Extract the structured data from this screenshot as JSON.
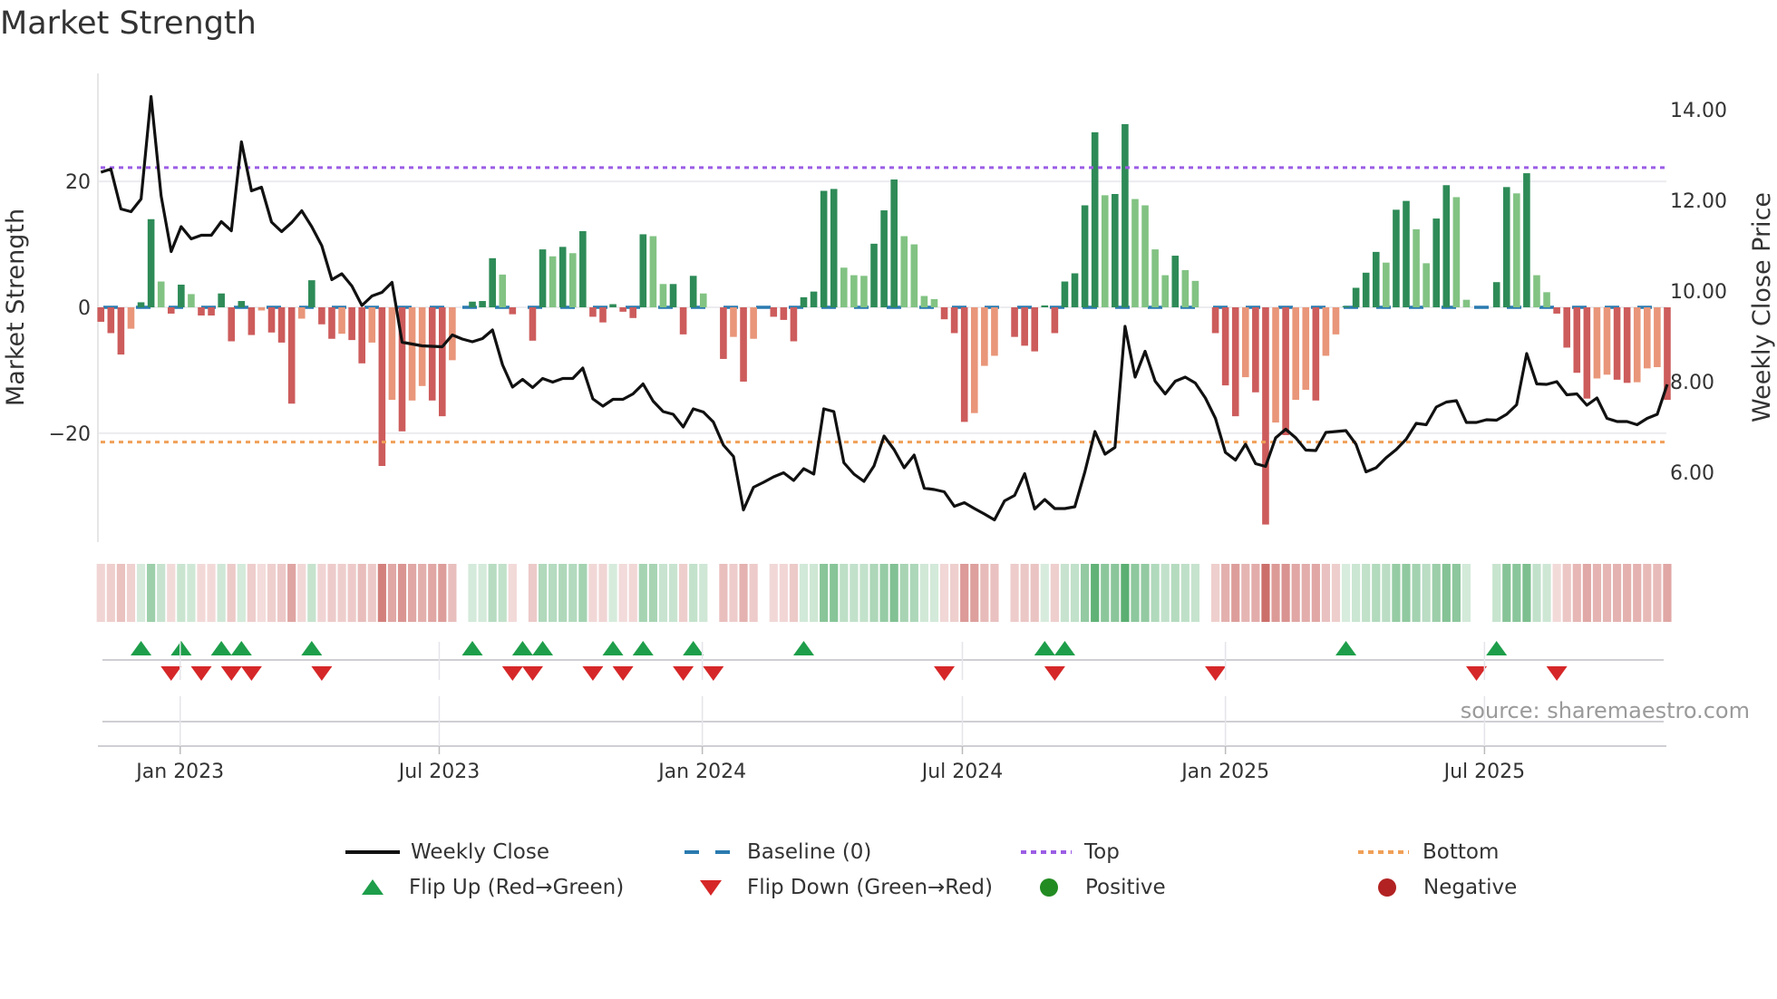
{
  "title": "Market Strength",
  "source": "source: sharemaestro.com",
  "legend": {
    "weekly_close": "Weekly Close",
    "baseline": "Baseline (0)",
    "top": "Top",
    "bottom": "Bottom",
    "flip_up": "Flip Up (Red→Green)",
    "flip_down": "Flip Down (Green→Red)",
    "positive": "Positive",
    "negative": "Negative"
  },
  "colors": {
    "price_line": "#111111",
    "baseline": "#2a7ab0",
    "top": "#9b5de5",
    "bottom": "#f0a058",
    "bar_up_strong": "#2e8b57",
    "bar_up_weak": "#82c383",
    "bar_down_strong": "#cd5c5c",
    "bar_down_weak": "#e9967a",
    "flip_up": "#1e9e4a",
    "flip_down": "#d62728",
    "positive": "#228b22",
    "negative": "#b22222"
  },
  "chart_data": {
    "type": "bar+line",
    "title": "Market Strength",
    "ylabel": "Market Strength",
    "y2label": "Weekly Close Price",
    "ylim": [
      -37.3,
      37.3
    ],
    "y2lim": [
      4.5,
      14.7
    ],
    "yticks": [
      {
        "v": -20,
        "label": "−20"
      },
      {
        "v": 0,
        "label": "0"
      },
      {
        "v": 20,
        "label": "20"
      }
    ],
    "y2ticks": [
      {
        "v": 6,
        "label": "6.00"
      },
      {
        "v": 8,
        "label": "8.00"
      },
      {
        "v": 10,
        "label": "10.00"
      },
      {
        "v": 12,
        "label": "12.00"
      },
      {
        "v": 14,
        "label": "14.00"
      }
    ],
    "xticks": [
      {
        "week": 7.9,
        "label": "Jan 2023"
      },
      {
        "week": 33.7,
        "label": "Jul 2023"
      },
      {
        "week": 59.9,
        "label": "Jan 2024"
      },
      {
        "week": 85.8,
        "label": "Jul 2024"
      },
      {
        "week": 112.0,
        "label": "Jan 2025"
      },
      {
        "week": 137.8,
        "label": "Jul 2025"
      }
    ],
    "top_level": 22.2,
    "bottom_level": -21.4,
    "baseline": 0,
    "strength": [
      -2.3,
      -4.1,
      -7.5,
      -3.4,
      0.8,
      14,
      4.1,
      -1,
      3.6,
      2.1,
      -1.3,
      -1.3,
      2.2,
      -5.4,
      1.0,
      -4.4,
      -0.5,
      -4,
      -5.6,
      -15.3,
      -1.8,
      4.3,
      -2.7,
      -5,
      -4.2,
      -5.2,
      -8.9,
      -5.6,
      -25.2,
      -14.7,
      -19.7,
      -14.8,
      -12.5,
      -14.8,
      -17.3,
      -8.4,
      0,
      0.9,
      1.0,
      7.8,
      5.2,
      -1.1,
      0,
      -5.3,
      9.2,
      8.1,
      9.6,
      8.6,
      12.1,
      -1.5,
      -2.4,
      0.5,
      -0.7,
      -1.7,
      11.6,
      11.3,
      3.7,
      3.7,
      -4.3,
      5.0,
      2.2,
      0,
      -8.2,
      -4.7,
      -11.8,
      -5,
      0,
      -1.5,
      -2,
      -5.4,
      1.6,
      2.5,
      18.5,
      18.8,
      6.3,
      5.1,
      5,
      10.1,
      15.4,
      20.3,
      11.3,
      10.0,
      1.8,
      1.3,
      -1.9,
      -4.1,
      -18.2,
      -16.8,
      -9.3,
      -7.7,
      0,
      -4.7,
      -6.1,
      -7,
      0.3,
      -4.1,
      4.1,
      5.4,
      16.2,
      27.8,
      17.8,
      18,
      29.1,
      17.2,
      16.2,
      9.2,
      5.1,
      8.2,
      5.9,
      4.2,
      0,
      -4.1,
      -12.4,
      -17.3,
      -11.1,
      -13.5,
      -34.5,
      -18.3,
      -20.3,
      -14.7,
      -13.1,
      -14.8,
      -7.7,
      -4.3,
      0.2,
      3.1,
      5.5,
      8.8,
      7.1,
      15.5,
      16.9,
      12.4,
      7,
      14.1,
      19.4,
      17.5,
      1.2,
      0,
      0,
      4,
      19.1,
      18.1,
      21.3,
      5.1,
      2.4,
      -1,
      -6.4,
      -10.4,
      -14.5,
      -11.3,
      -10.7,
      -11.5,
      -12,
      -11.9,
      -9.7,
      -9.5,
      -14.7
    ],
    "price": [
      12.62,
      12.69,
      11.81,
      11.75,
      12.03,
      14.29,
      12.1,
      10.87,
      11.42,
      11.15,
      11.23,
      11.23,
      11.53,
      11.33,
      13.29,
      12.21,
      12.29,
      11.52,
      11.31,
      11.51,
      11.77,
      11.42,
      11.0,
      10.25,
      10.38,
      10.11,
      9.68,
      9.89,
      9.97,
      10.19,
      8.87,
      8.83,
      8.79,
      8.78,
      8.77,
      9.03,
      8.94,
      8.88,
      8.95,
      9.14,
      8.37,
      7.88,
      8.05,
      7.87,
      8.07,
      7.99,
      8.07,
      8.07,
      8.3,
      7.62,
      7.46,
      7.61,
      7.61,
      7.73,
      7.95,
      7.57,
      7.34,
      7.28,
      7.0,
      7.4,
      7.33,
      7.11,
      6.6,
      6.35,
      5.17,
      5.67,
      5.78,
      5.9,
      5.99,
      5.82,
      6.08,
      5.96,
      7.4,
      7.34,
      6.21,
      5.96,
      5.8,
      6.14,
      6.8,
      6.5,
      6.1,
      6.38,
      5.65,
      5.62,
      5.57,
      5.25,
      5.33,
      5.2,
      5.08,
      4.95,
      5.37,
      5.49,
      5.97,
      5.19,
      5.4,
      5.2,
      5.2,
      5.24,
      6.01,
      6.9,
      6.4,
      6.55,
      9.22,
      8.1,
      8.67,
      8.01,
      7.73,
      8.01,
      8.1,
      7.97,
      7.64,
      7.19,
      6.44,
      6.27,
      6.62,
      6.19,
      6.13,
      6.76,
      6.95,
      6.76,
      6.49,
      6.48,
      6.88,
      6.9,
      6.92,
      6.62,
      6.01,
      6.1,
      6.32,
      6.5,
      6.73,
      7.08,
      7.05,
      7.44,
      7.55,
      7.58,
      7.1,
      7.1,
      7.16,
      7.15,
      7.28,
      7.49,
      8.62,
      7.95,
      7.94,
      8.0,
      7.71,
      7.73,
      7.48,
      7.64,
      7.19,
      7.12,
      7.12,
      7.05,
      7.19,
      7.28,
      7.94
    ],
    "flips_up": [
      4,
      8,
      12,
      14,
      21,
      37,
      42,
      44,
      51,
      54,
      59,
      70,
      94,
      96,
      124,
      139
    ],
    "flips_down": [
      7,
      10,
      13,
      15,
      22,
      41,
      43,
      49,
      52,
      58,
      61,
      84,
      95,
      111,
      137,
      145
    ]
  }
}
